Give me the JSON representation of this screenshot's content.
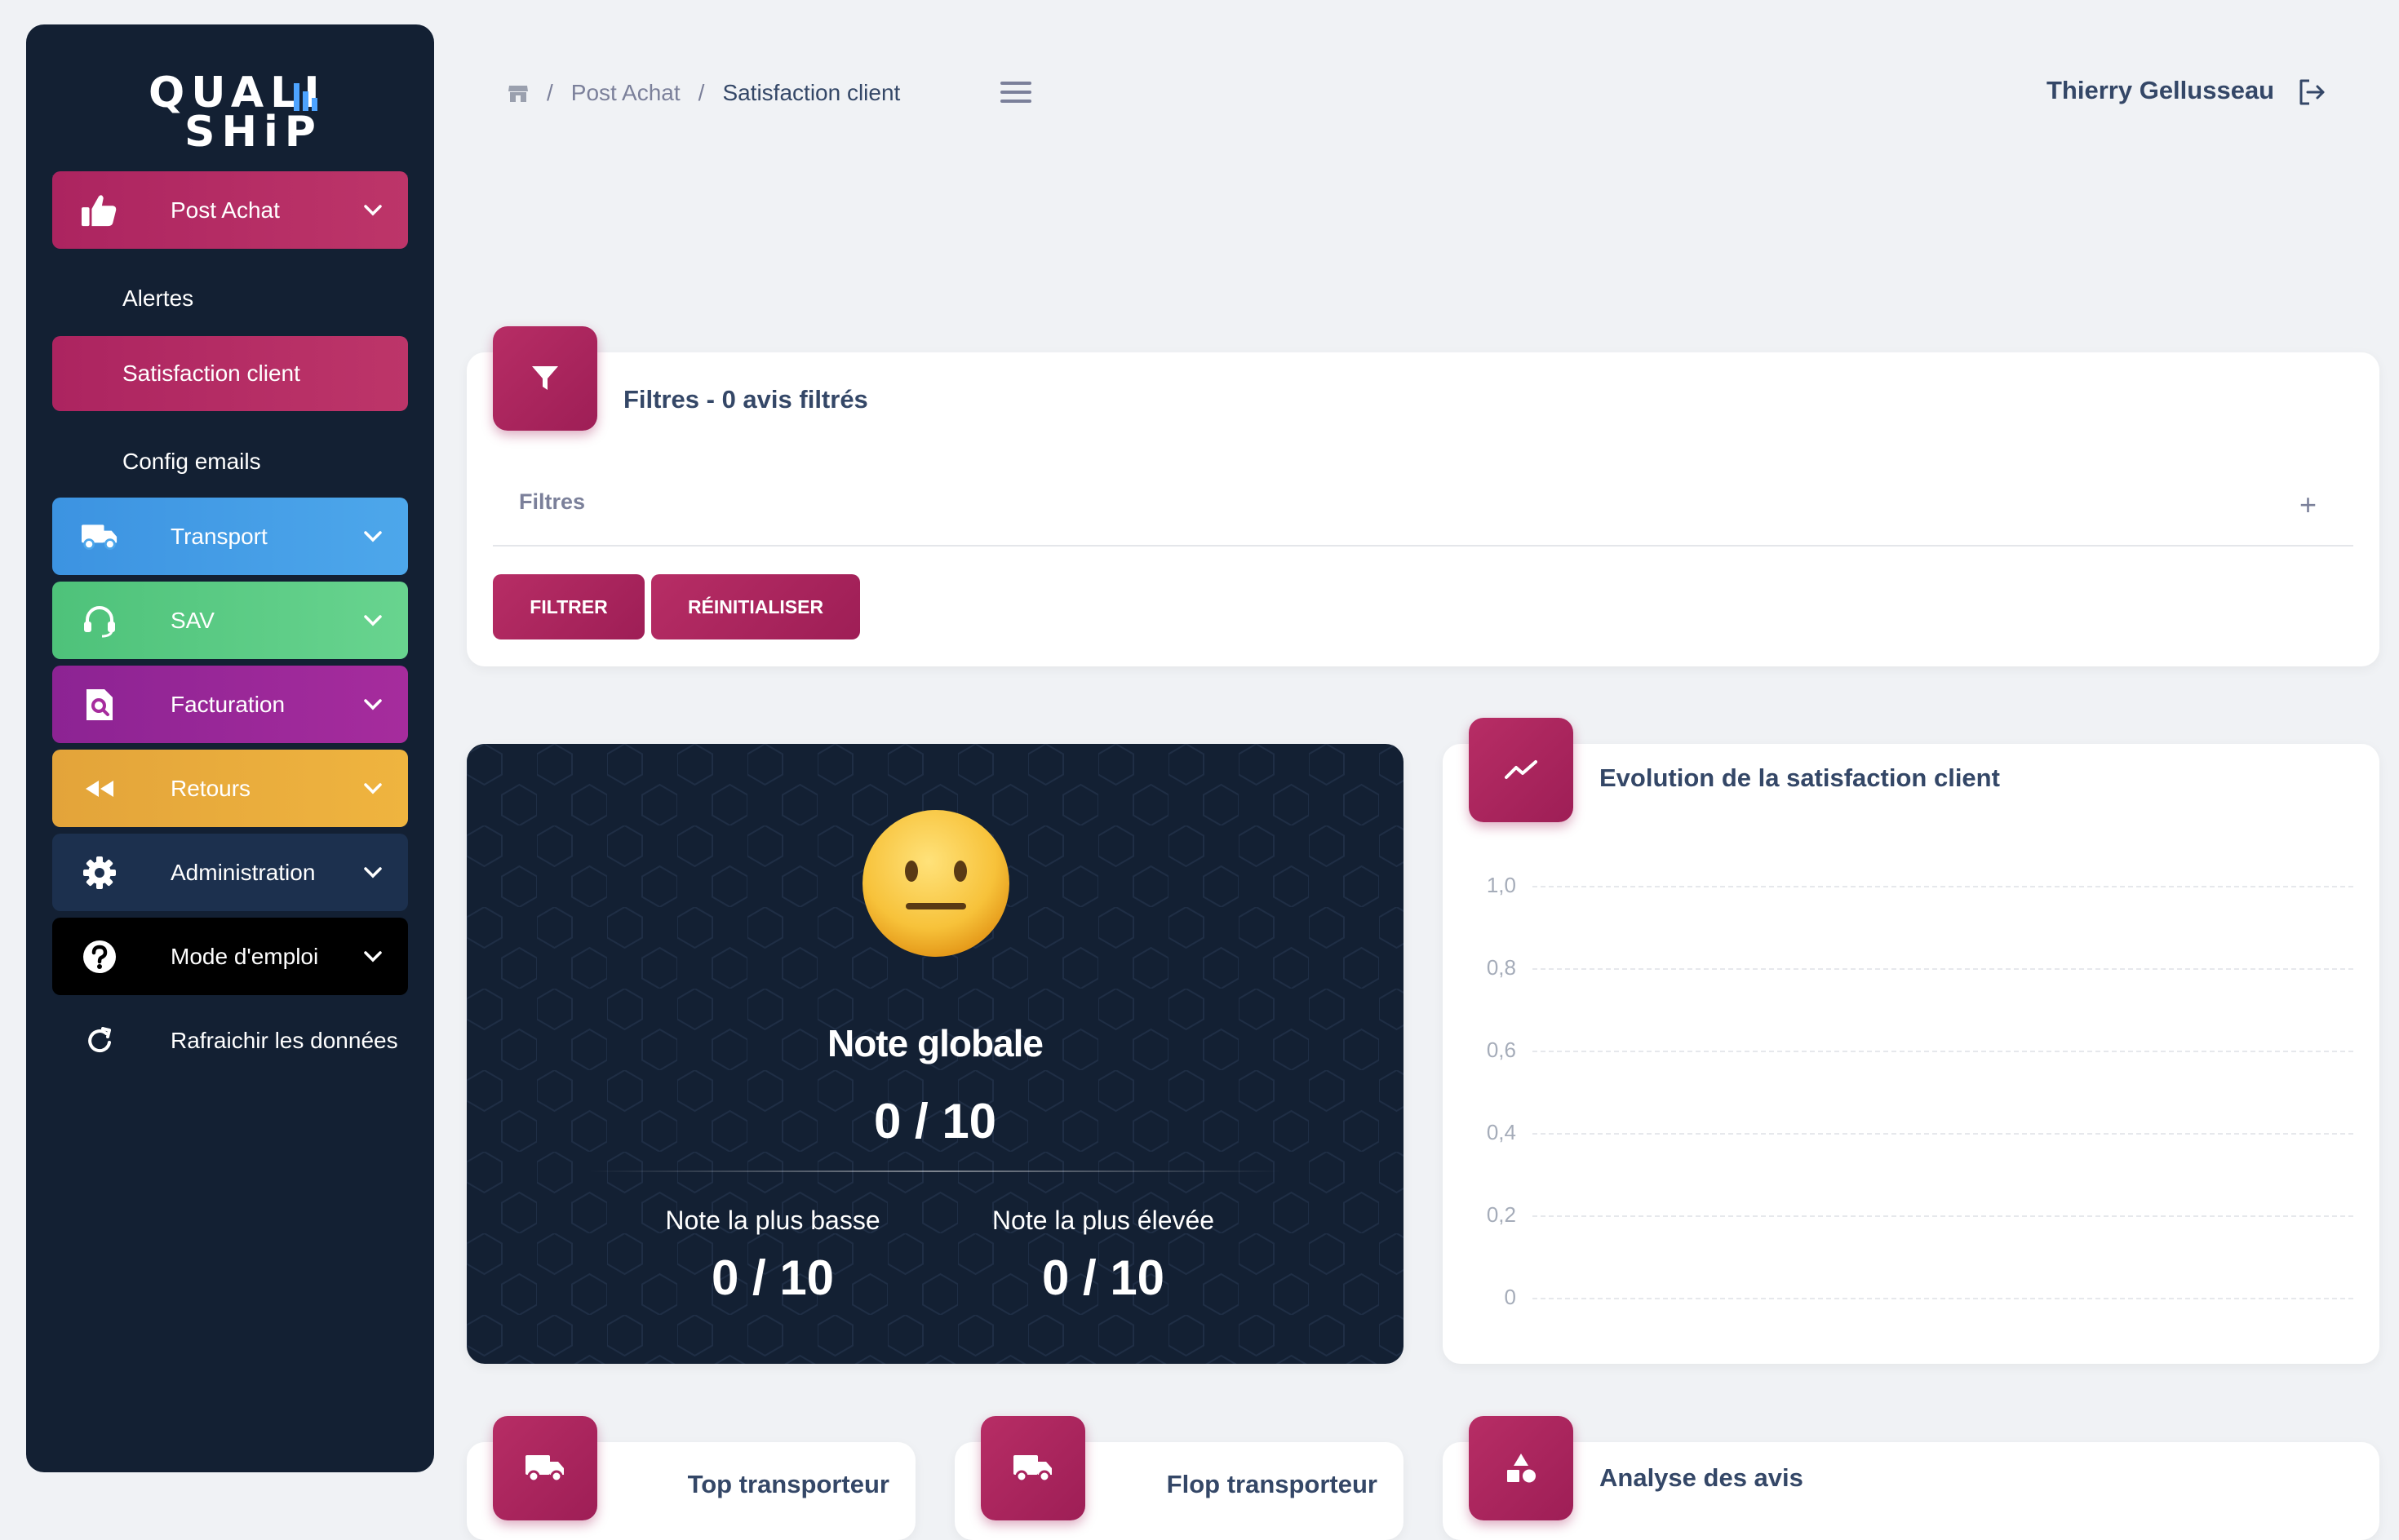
{
  "logo": {
    "line1": "QUALI",
    "line2": "SHiP"
  },
  "sidebar": {
    "post_achat": "Post Achat",
    "sub_items": [
      "Alertes",
      "Satisfaction client",
      "Config emails"
    ],
    "transport": "Transport",
    "sav": "SAV",
    "facturation": "Facturation",
    "retours": "Retours",
    "administration": "Administration",
    "mode_emploi": "Mode d'emploi",
    "refresh": "Rafraichir les données"
  },
  "breadcrumb": {
    "sep": "/",
    "parent": "Post Achat",
    "current": "Satisfaction client"
  },
  "user": {
    "name": "Thierry Gellusseau"
  },
  "filters": {
    "title": "Filtres - 0 avis filtrés",
    "accordion_label": "Filtres",
    "plus": "+",
    "filter_button": "FILTRER",
    "reset_button": "RÉINITIALISER"
  },
  "note": {
    "title": "Note globale",
    "value": "0 / 10",
    "lowest_label": "Note la plus basse",
    "lowest_value": "0 / 10",
    "highest_label": "Note la plus élevée",
    "highest_value": "0 / 10"
  },
  "chart_data": {
    "type": "line",
    "title": "Evolution de la satisfaction client",
    "y_ticks": [
      "1,0",
      "0,8",
      "0,6",
      "0,4",
      "0,2",
      "0"
    ],
    "ylim": [
      0,
      1
    ],
    "grid": true,
    "series": []
  },
  "bottom_cards": {
    "top": "Top transporteur",
    "flop": "Flop transporteur",
    "analyse": "Analyse des avis"
  },
  "colors": {
    "accent": "#b0285f",
    "sidebar_bg": "#132033",
    "transport": "#4da7eb",
    "sav": "#68d48f",
    "facturation": "#a62c9d",
    "retours": "#efb43f",
    "administration": "#1c304e",
    "logo_bars": "#4da3ff"
  },
  "icons": {
    "post_achat": "thumbs-up-icon",
    "transport": "truck-icon",
    "sav": "headset-icon",
    "facturation": "invoice-search-icon",
    "retours": "rewind-icon",
    "administration": "gear-icon",
    "mode_emploi": "question-icon",
    "refresh": "refresh-icon",
    "filter": "funnel-icon",
    "chart": "trend-icon",
    "analyse": "shapes-icon"
  }
}
